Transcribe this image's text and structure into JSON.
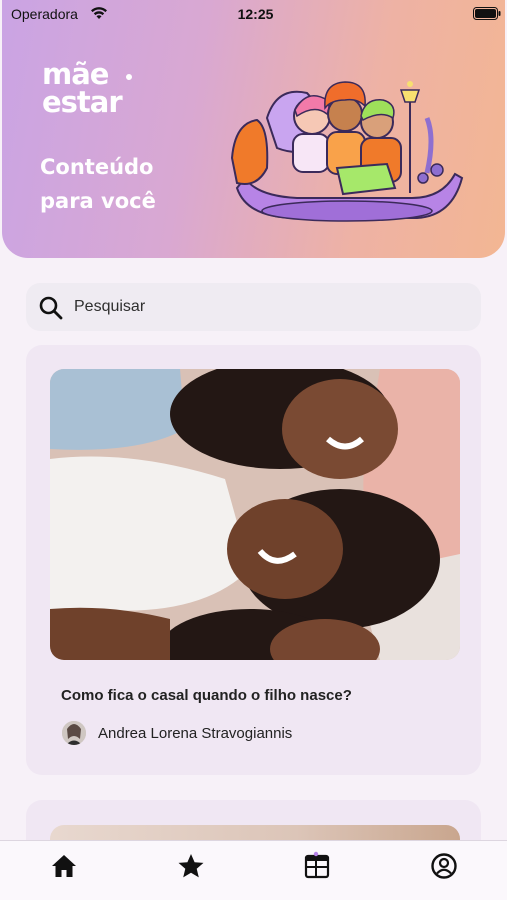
{
  "status_bar": {
    "carrier": "Operadora",
    "time": "12:25"
  },
  "header": {
    "logo_line1": "mãe",
    "logo_line2": "estar",
    "tagline_line1": "Conteúdo",
    "tagline_line2": "para você"
  },
  "search": {
    "placeholder": "Pesquisar"
  },
  "articles": [
    {
      "title": "Como fica o casal quando o filho nasce?",
      "author": "Andrea Lorena Stravogiannis"
    }
  ],
  "tabbar": {
    "items": [
      "home-icon",
      "star-icon",
      "calendar-icon",
      "profile-icon"
    ]
  },
  "colors": {
    "header_gradient_start": "#caa4e4",
    "header_gradient_end": "#f3b693",
    "card_background": "#f0e7f3",
    "page_background": "#f7f1f8"
  }
}
